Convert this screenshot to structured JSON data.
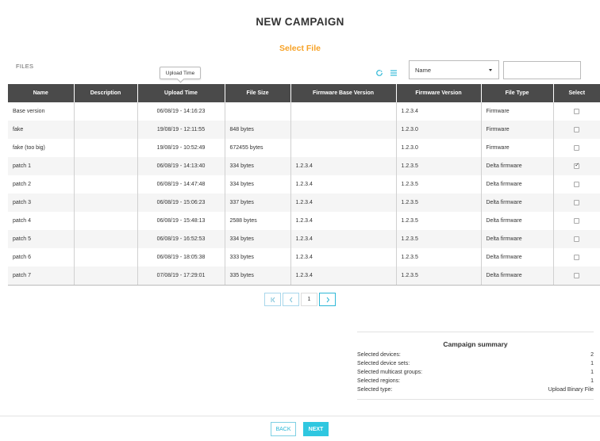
{
  "page": {
    "title": "NEW CAMPAIGN",
    "subtitle": "Select File",
    "files_label": "FILES"
  },
  "tooltip": {
    "text": "Upload Time"
  },
  "toolbar": {
    "refresh_icon": "refresh-icon",
    "list_icon": "list-icon",
    "accent_color": "#2fb8d7",
    "sort_select": {
      "selected": "Name"
    },
    "filter_input": {
      "value": "",
      "placeholder": ""
    }
  },
  "table": {
    "headers": [
      "Name",
      "Description",
      "Upload Time",
      "File Size",
      "Firmware Base Version",
      "Firmware Version",
      "File Type",
      "Select"
    ],
    "rows": [
      {
        "name": "Base version",
        "description": "",
        "upload_time": "06/08/19 - 14:16:23",
        "file_size": "",
        "base_version": "",
        "version": "1.2.3.4",
        "file_type": "Firmware",
        "selected": false
      },
      {
        "name": "fake",
        "description": "",
        "upload_time": "19/08/19 - 12:11:55",
        "file_size": "848 bytes",
        "base_version": "",
        "version": "1.2.3.0",
        "file_type": "Firmware",
        "selected": false
      },
      {
        "name": "fake (too big)",
        "description": "",
        "upload_time": "19/08/19 - 10:52:49",
        "file_size": "672455 bytes",
        "base_version": "",
        "version": "1.2.3.0",
        "file_type": "Firmware",
        "selected": false
      },
      {
        "name": "patch 1",
        "description": "",
        "upload_time": "06/08/19 - 14:13:40",
        "file_size": "334 bytes",
        "base_version": "1.2.3.4",
        "version": "1.2.3.5",
        "file_type": "Delta firmware",
        "selected": true
      },
      {
        "name": "patch 2",
        "description": "",
        "upload_time": "06/08/19 - 14:47:48",
        "file_size": "334 bytes",
        "base_version": "1.2.3.4",
        "version": "1.2.3.5",
        "file_type": "Delta firmware",
        "selected": false
      },
      {
        "name": "patch 3",
        "description": "",
        "upload_time": "06/08/19 - 15:06:23",
        "file_size": "337 bytes",
        "base_version": "1.2.3.4",
        "version": "1.2.3.5",
        "file_type": "Delta firmware",
        "selected": false
      },
      {
        "name": "patch 4",
        "description": "",
        "upload_time": "06/08/19 - 15:48:13",
        "file_size": "2588 bytes",
        "base_version": "1.2.3.4",
        "version": "1.2.3.5",
        "file_type": "Delta firmware",
        "selected": false
      },
      {
        "name": "patch 5",
        "description": "",
        "upload_time": "06/08/19 - 16:52:53",
        "file_size": "334 bytes",
        "base_version": "1.2.3.4",
        "version": "1.2.3.5",
        "file_type": "Delta firmware",
        "selected": false
      },
      {
        "name": "patch 6",
        "description": "",
        "upload_time": "06/08/19 - 18:05:38",
        "file_size": "333 bytes",
        "base_version": "1.2.3.4",
        "version": "1.2.3.5",
        "file_type": "Delta firmware",
        "selected": false
      },
      {
        "name": "patch 7",
        "description": "",
        "upload_time": "07/08/19 - 17:29:01",
        "file_size": "335 bytes",
        "base_version": "1.2.3.4",
        "version": "1.2.3.5",
        "file_type": "Delta firmware",
        "selected": false
      }
    ]
  },
  "pagination": {
    "first_icon": "first-page-icon",
    "prev_icon": "prev-page-icon",
    "current_page": "1",
    "next_icon": "next-page-icon"
  },
  "summary": {
    "title": "Campaign summary",
    "rows": [
      {
        "label": "Selected devices:",
        "value": "2"
      },
      {
        "label": "Selected device sets:",
        "value": "1"
      },
      {
        "label": "Selected multicast groups:",
        "value": "1"
      },
      {
        "label": "Selected regions:",
        "value": "1"
      },
      {
        "label": "Selected type:",
        "value": "Upload Binary File"
      }
    ]
  },
  "footer": {
    "back_label": "BACK",
    "next_label": "NEXT"
  }
}
